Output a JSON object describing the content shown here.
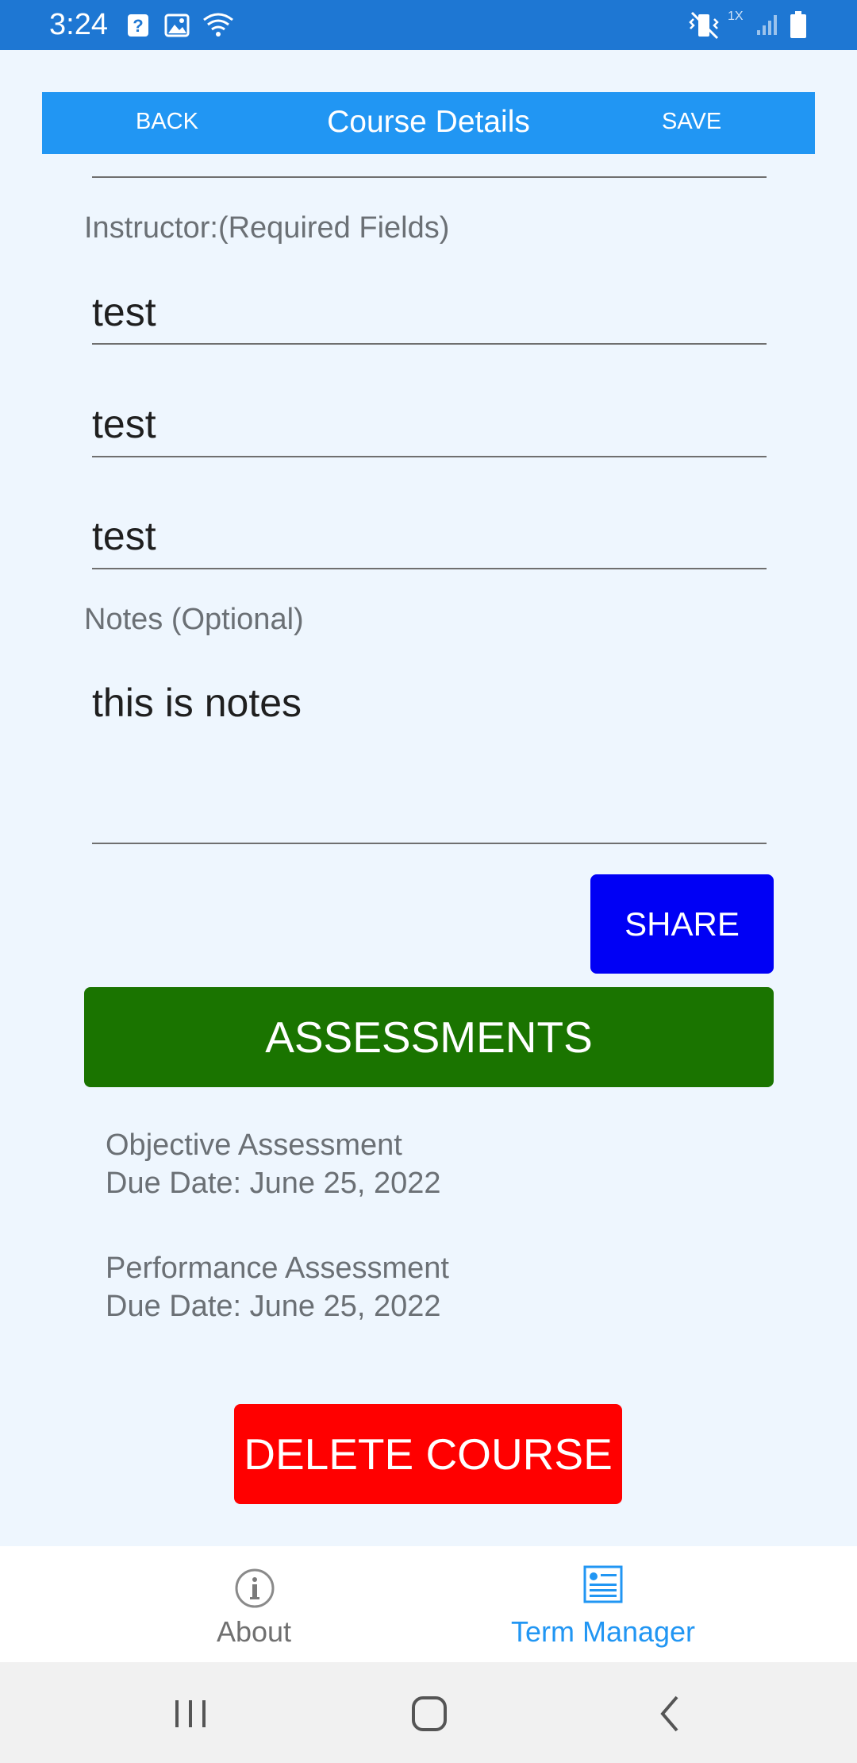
{
  "status_bar": {
    "time": "3:24",
    "left_icons": [
      "help-box-icon",
      "image-icon",
      "wifi-question-icon"
    ],
    "right_icons": [
      "vibrate-icon",
      "signal-icon",
      "battery-icon"
    ],
    "signal_label": "1X"
  },
  "header": {
    "back_label": "BACK",
    "title": "Course Details",
    "save_label": "SAVE",
    "color": "#2196F3"
  },
  "form": {
    "instructor_label": "Instructor:(Required Fields)",
    "instructor_name": "test",
    "instructor_phone": "test",
    "instructor_email": "test",
    "notes_label": "Notes (Optional)",
    "notes_value": "this is notes"
  },
  "buttons": {
    "share_label": "SHARE",
    "assessments_label": "ASSESSMENTS",
    "delete_label": "DELETE COURSE"
  },
  "assessments": [
    {
      "name": "Objective Assessment",
      "due": "Due Date: June 25, 2022"
    },
    {
      "name": "Performance Assessment",
      "due": "Due Date: June 25, 2022"
    }
  ],
  "tabs": [
    {
      "label": "About",
      "icon": "info-icon",
      "active": false
    },
    {
      "label": "Term Manager",
      "icon": "document-icon",
      "active": true
    }
  ],
  "colors": {
    "status_bar": "#1E77D3",
    "background": "#EEF6FE",
    "share": "#0000F5",
    "assessments": "#1A7400",
    "delete": "#FF0000",
    "tab_active": "#2196F3",
    "tab_inactive": "#707070"
  }
}
